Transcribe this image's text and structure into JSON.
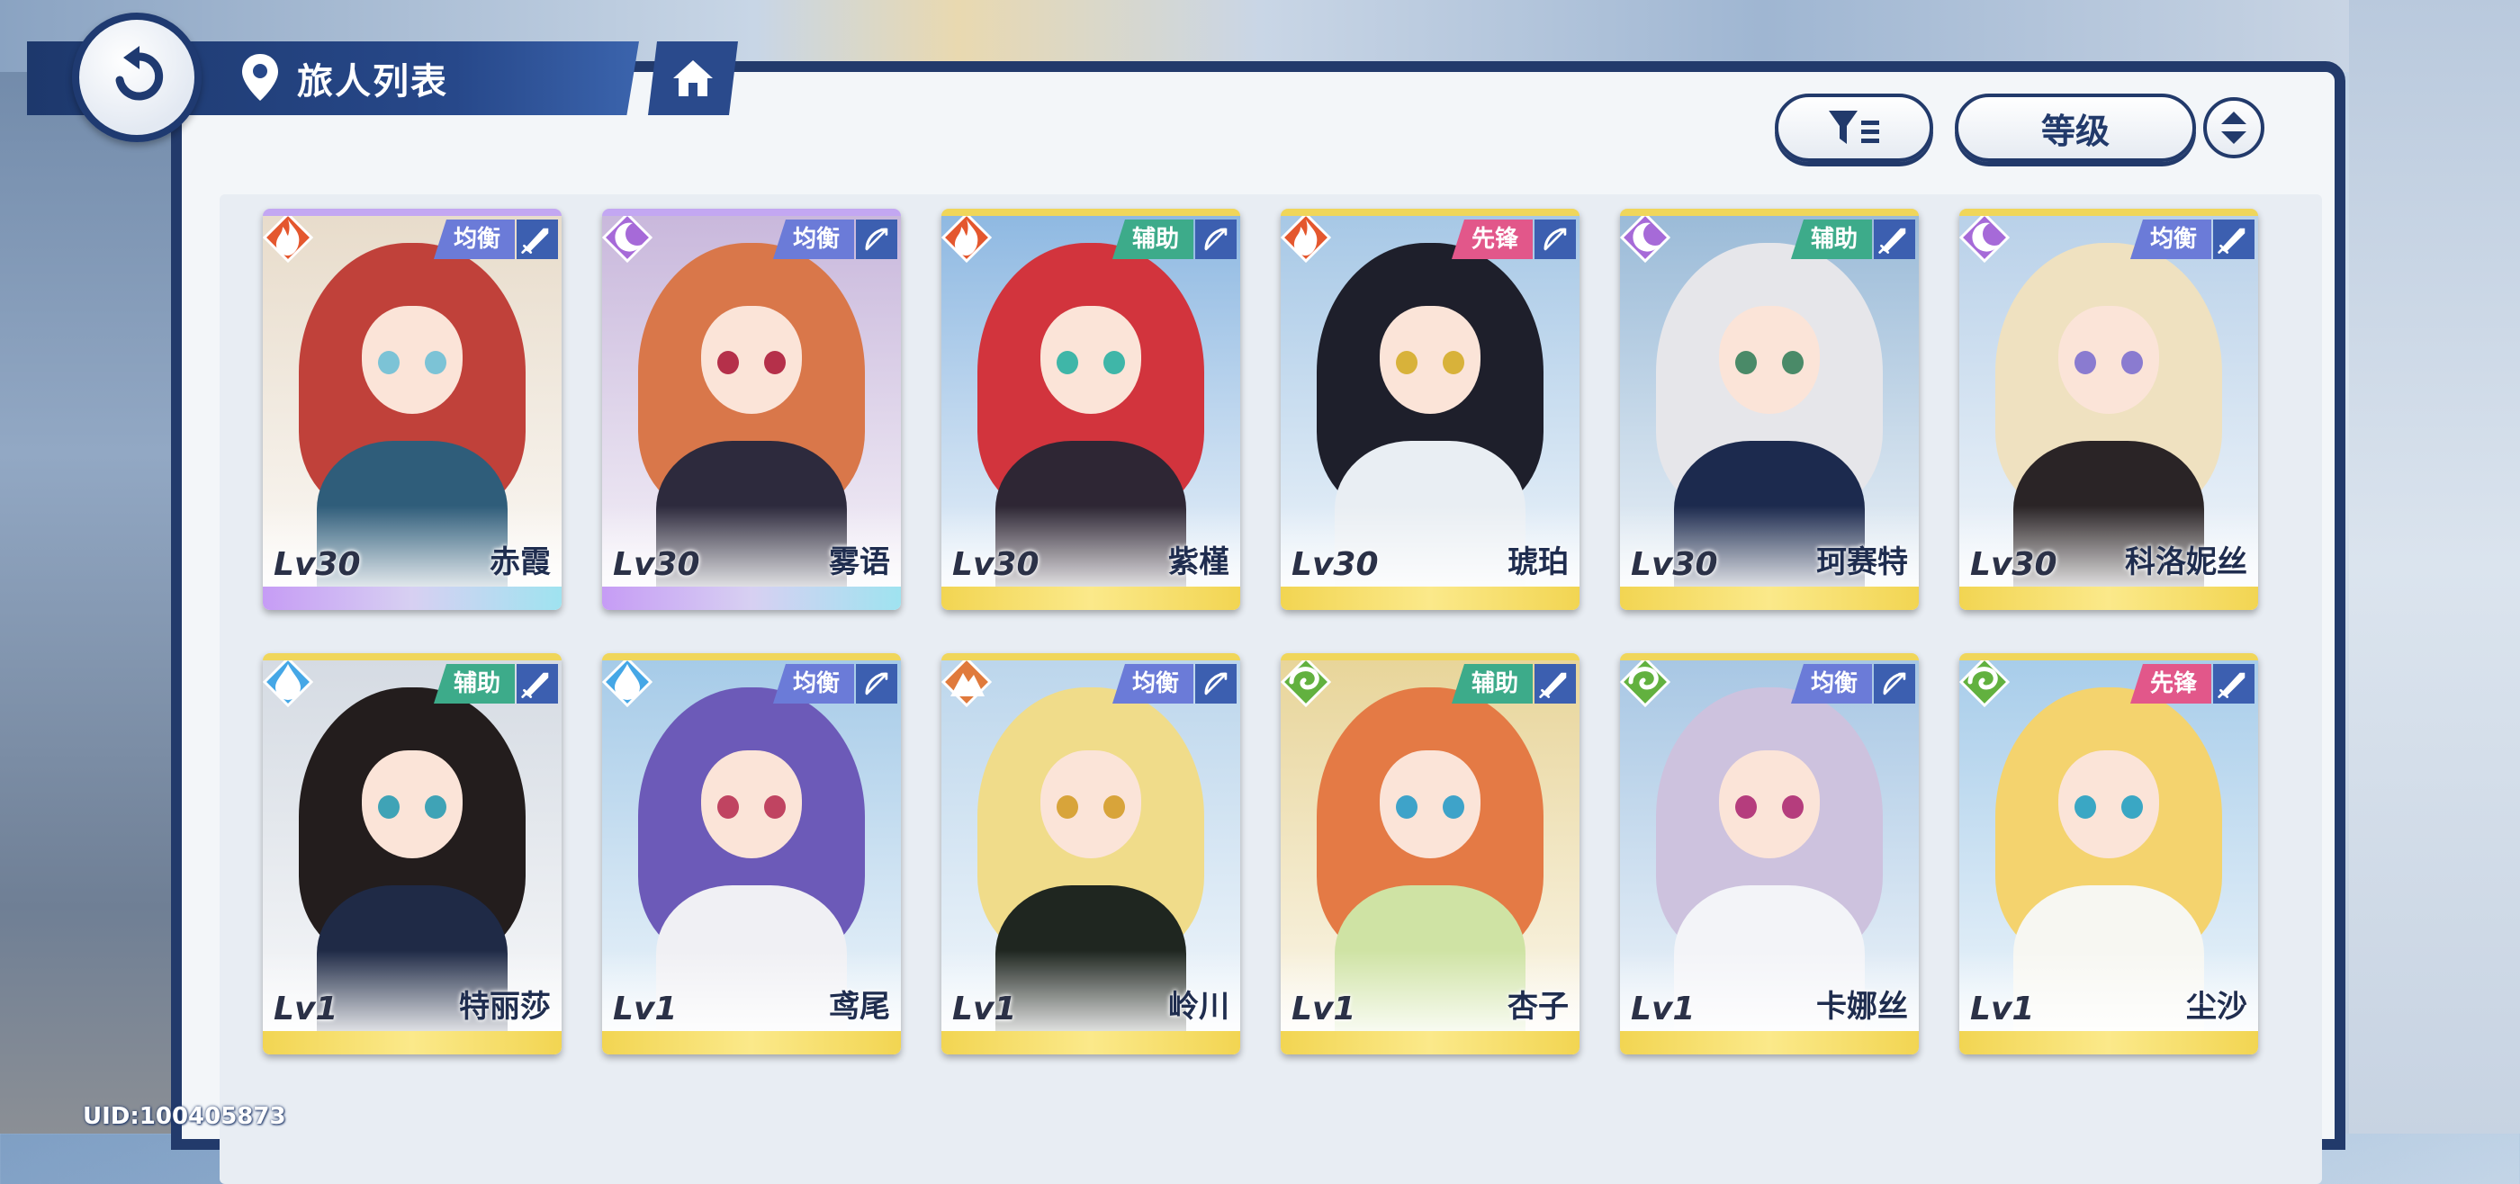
{
  "header": {
    "title": "旅人列表"
  },
  "toolbar": {
    "sort_label": "等级"
  },
  "footer": {
    "uid": "UID:100405873"
  },
  "colors": {
    "navy": "#223a6b",
    "fire": "#e4572e",
    "moon": "#a66ad8",
    "water": "#45a7e6",
    "earth": "#e07a3c",
    "wind": "#62b13f",
    "role_balance": "#6b7bd8",
    "role_support": "#3dab8a",
    "role_vanguard": "#e2578a"
  },
  "characters": [
    {
      "name": "赤霞",
      "level": "Lv30",
      "role": "均衡",
      "element": "fire",
      "weapon": "sword",
      "rarity": "rare",
      "hair": "#c0413a",
      "eye": "#7cc3d6",
      "outfit": "#2f5d7a",
      "sky": "#e8dccb"
    },
    {
      "name": "雾语",
      "level": "Lv30",
      "role": "均衡",
      "element": "moon",
      "weapon": "bow",
      "rarity": "rare",
      "hair": "#d9774a",
      "eye": "#b5304a",
      "outfit": "#2d2a3d",
      "sky": "#c9b8dc"
    },
    {
      "name": "紫槿",
      "level": "Lv30",
      "role": "辅助",
      "element": "fire",
      "weapon": "bow",
      "rarity": "normal",
      "hair": "#d2343d",
      "eye": "#3fb6a8",
      "outfit": "#2e2634",
      "sky": "#8fb9e2"
    },
    {
      "name": "琥珀",
      "level": "Lv30",
      "role": "先锋",
      "element": "fire",
      "weapon": "bow",
      "rarity": "normal",
      "hair": "#1e1f2b",
      "eye": "#d8b23a",
      "outfit": "#e9eef3",
      "sky": "#a7c8e6"
    },
    {
      "name": "珂赛特",
      "level": "Lv30",
      "role": "辅助",
      "element": "moon",
      "weapon": "sword",
      "rarity": "normal",
      "hair": "#e6e6ea",
      "eye": "#4a8a68",
      "outfit": "#1c2a4e",
      "sky": "#9bbbd8"
    },
    {
      "name": "科洛妮丝",
      "level": "Lv30",
      "role": "均衡",
      "element": "moon",
      "weapon": "sword",
      "rarity": "normal",
      "hair": "#efe1c0",
      "eye": "#8a7bd0",
      "outfit": "#2a2426",
      "sky": "#b9d1e9"
    },
    {
      "name": "特丽莎",
      "level": "Lv1",
      "role": "辅助",
      "element": "water",
      "weapon": "sword",
      "rarity": "normal",
      "hair": "#231d1d",
      "eye": "#3fa3b6",
      "outfit": "#1f2a46",
      "sky": "#d5dbe3"
    },
    {
      "name": "鸢尾",
      "level": "Lv1",
      "role": "均衡",
      "element": "water",
      "weapon": "bow",
      "rarity": "normal",
      "hair": "#6c5ab8",
      "eye": "#c04461",
      "outfit": "#f0f0f4",
      "sky": "#a6cbe8"
    },
    {
      "name": "岭川",
      "level": "Lv1",
      "role": "均衡",
      "element": "earth",
      "weapon": "bow",
      "rarity": "normal",
      "hair": "#f0dc8a",
      "eye": "#d8a43a",
      "outfit": "#1f2620",
      "sky": "#bcd6ec"
    },
    {
      "name": "杏子",
      "level": "Lv1",
      "role": "辅助",
      "element": "wind",
      "weapon": "sword",
      "rarity": "normal",
      "hair": "#e47a45",
      "eye": "#3ea3c9",
      "outfit": "#cfe3a4",
      "sky": "#e8d59a"
    },
    {
      "name": "卡娜丝",
      "level": "Lv1",
      "role": "均衡",
      "element": "wind",
      "weapon": "bow",
      "rarity": "normal",
      "hair": "#cdc2de",
      "eye": "#b53d7d",
      "outfit": "#f3f4f8",
      "sky": "#a8c7e4"
    },
    {
      "name": "尘沙",
      "level": "Lv1",
      "role": "先锋",
      "element": "wind",
      "weapon": "sword",
      "rarity": "normal",
      "hair": "#f4d36e",
      "eye": "#3aa7c4",
      "outfit": "#f7f7f2",
      "sky": "#a8cdea"
    }
  ]
}
